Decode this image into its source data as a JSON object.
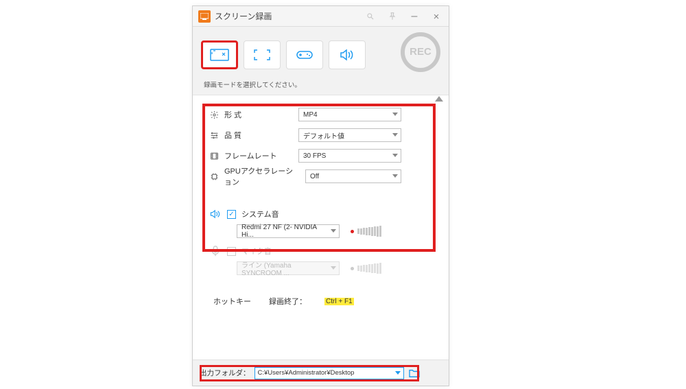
{
  "window": {
    "title": "スクリーン録画",
    "minimize": "–",
    "close": "×"
  },
  "toolbar": {
    "hint": "録画モードを選択してください。",
    "rec_label": "REC",
    "modes": {
      "region": "region-icon",
      "fullscreen": "fullscreen-icon",
      "game": "game-icon",
      "audio": "audio-icon"
    }
  },
  "settings": {
    "format": {
      "label": "形 式",
      "value": "MP4"
    },
    "quality": {
      "label": "品 質",
      "value": "デフォルト値"
    },
    "framerate": {
      "label": "フレームレート",
      "value": "30 FPS"
    },
    "gpu": {
      "label": "GPUアクセラレーション",
      "value": "Off"
    }
  },
  "audio": {
    "system": {
      "label": "システム音",
      "enabled": true,
      "device": "Redmi 27 NF (2- NVIDIA Hi..."
    },
    "mic": {
      "label": "マイク音",
      "enabled": false,
      "device": "ライン (Yamaha SYNCROOM ..."
    }
  },
  "hotkey": {
    "title": "ホットキー",
    "stop_label": "録画終了：",
    "stop_value": "Ctrl + F1"
  },
  "output": {
    "label": "出力フォルダ：",
    "path": "C:¥Users¥Administrator¥Desktop"
  }
}
